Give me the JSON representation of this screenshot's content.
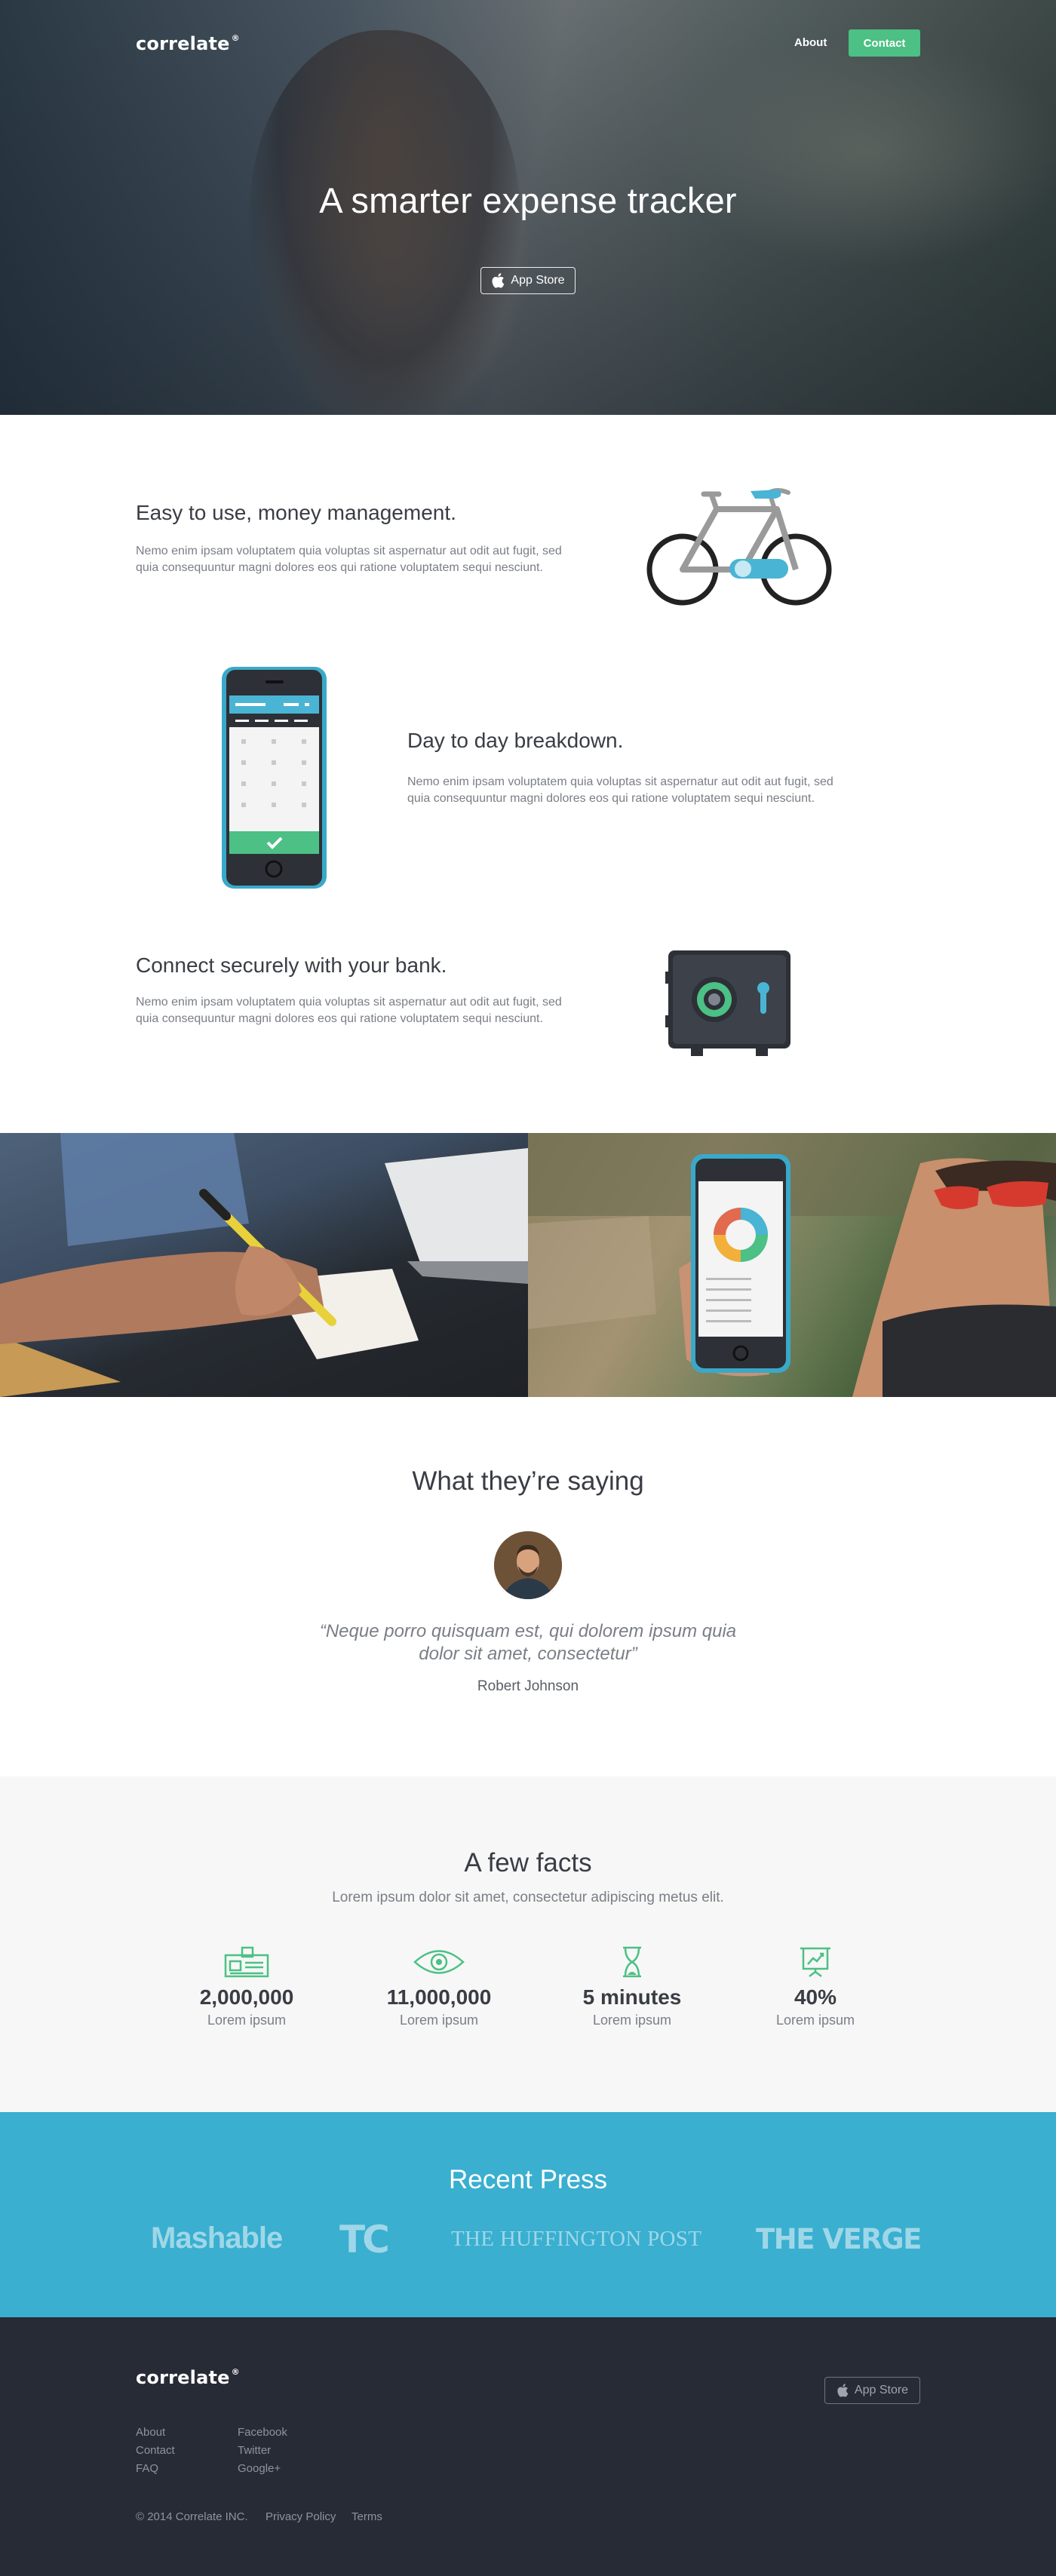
{
  "brand": {
    "name": "correlate",
    "mark": "®",
    "accent": "#4cc085",
    "press_blue": "#3aafd0",
    "footer_bg": "#272b36"
  },
  "nav": {
    "about": "About",
    "contact": "Contact"
  },
  "hero": {
    "title": "A smarter expense tracker",
    "app_store": "App Store",
    "app_store_icon": "apple-icon"
  },
  "features": [
    {
      "title": "Easy to use, money management.",
      "text": "Nemo enim ipsam voluptatem quia voluptas sit aspernatur aut odit aut fugit, sed quia consequuntur magni dolores eos qui ratione voluptatem sequi nesciunt.",
      "icon": "bicycle-icon"
    },
    {
      "title": "Day to day breakdown.",
      "text": "Nemo enim ipsam voluptatem quia voluptas sit aspernatur aut odit aut fugit, sed quia consequuntur magni dolores eos qui ratione voluptatem sequi nesciunt.",
      "icon": "phone-icon"
    },
    {
      "title": "Connect securely with your bank.",
      "text": "Nemo enim ipsam voluptatem quia voluptas sit aspernatur aut odit aut fugit, sed quia consequuntur magni dolores eos qui ratione voluptatem sequi nesciunt.",
      "icon": "safe-icon"
    }
  ],
  "testimonial": {
    "title": "What they’re saying",
    "quote": "“Neque porro quisquam est, qui dolorem ipsum quia dolor sit amet, consectetur”",
    "author": "Robert Johnson"
  },
  "facts": {
    "title": "A few facts",
    "subtitle": "Lorem ipsum dolor sit amet, consectetur adipiscing metus elit.",
    "items": [
      {
        "icon": "id-card-icon",
        "value": "2,000,000",
        "label": "Lorem ipsum"
      },
      {
        "icon": "eye-icon",
        "value": "11,000,000",
        "label": "Lorem ipsum"
      },
      {
        "icon": "hourglass-icon",
        "value": "5 minutes",
        "label": "Lorem ipsum"
      },
      {
        "icon": "presentation-chart-icon",
        "value": "40%",
        "label": "Lorem ipsum"
      }
    ]
  },
  "press": {
    "title": "Recent Press",
    "logos": [
      "Mashable",
      "TC",
      "THE HUFFINGTON POST",
      "THE VERGE"
    ]
  },
  "footer": {
    "app_store": "App Store",
    "col1": [
      "About",
      "Contact",
      "FAQ"
    ],
    "col2": [
      "Facebook",
      "Twitter",
      "Google+"
    ],
    "copyright": "© 2014 Correlate INC.",
    "privacy": "Privacy Policy",
    "terms": "Terms"
  }
}
